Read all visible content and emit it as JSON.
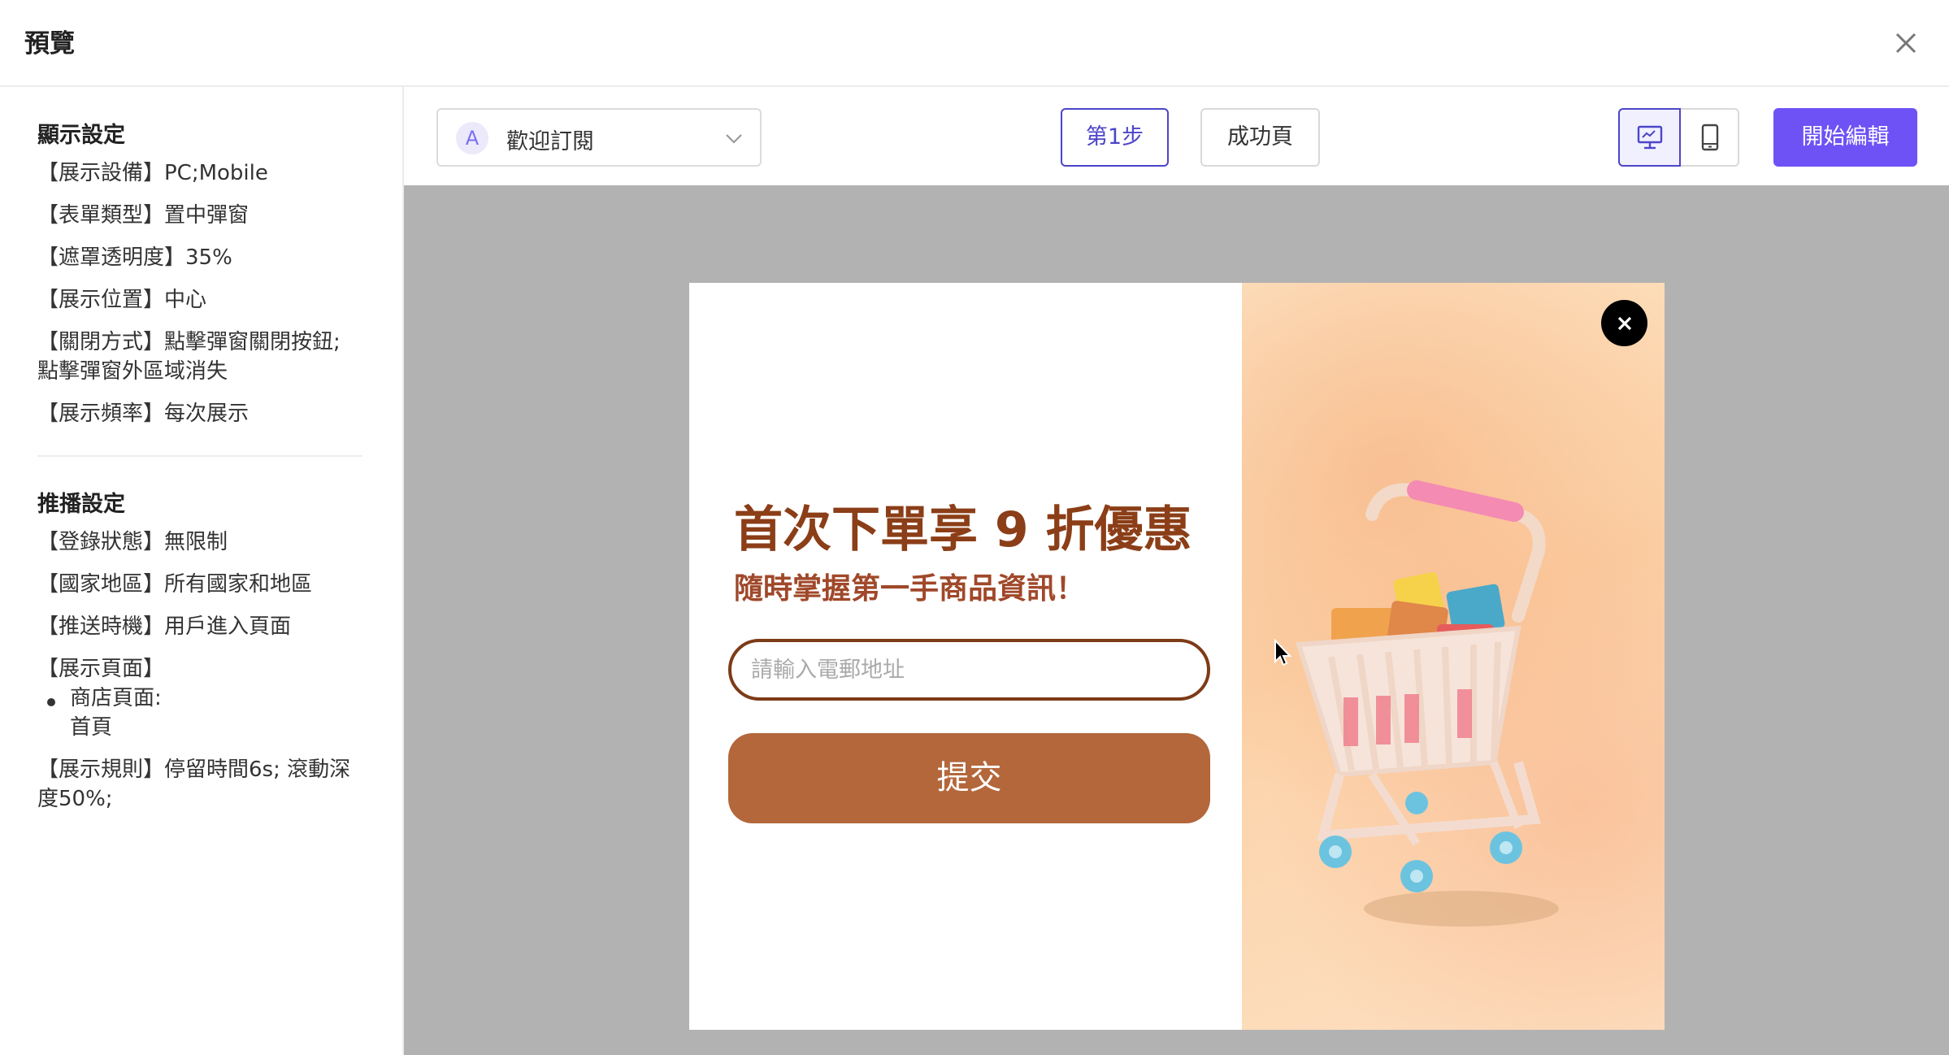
{
  "header": {
    "title": "預覽"
  },
  "sidebar": {
    "display_title": "顯示設定",
    "display_items": [
      "【展示設備】PC;Mobile",
      "【表單類型】置中彈窗",
      "【遮罩透明度】35%",
      "【展示位置】中心",
      "【關閉方式】點擊彈窗關閉按鈕;",
      "點擊彈窗外區域消失",
      "【展示頻率】每次展示"
    ],
    "push_title": "推播設定",
    "push_items": [
      "【登錄狀態】無限制",
      "【國家地區】所有國家和地區",
      "【推送時機】用戶進入頁面",
      "【展示頁面】",
      "商店頁面:",
      "首頁",
      "【展示規則】停留時間6s; 滾動深",
      "度50%;"
    ]
  },
  "toolbar": {
    "template_badge": "A",
    "template_name": "歡迎訂閱",
    "step1_label": "第1步",
    "success_label": "成功頁",
    "edit_label": "開始編輯"
  },
  "popup": {
    "heading": "首次下單享 9 折優惠",
    "subheading": "隨時掌握第一手商品資訊！",
    "email_placeholder": "請輸入電郵地址",
    "submit_label": "提交"
  },
  "colors": {
    "accent": "#4c45c9",
    "primary_button": "#6e52f5",
    "heading": "#8b3e17",
    "submit": "#b3673b",
    "overlay": "#b2b2b2"
  },
  "icons": [
    "close-icon",
    "chevron-down-icon",
    "desktop-icon",
    "mobile-icon",
    "popup-close-icon",
    "shopping-cart-illustration",
    "mouse-cursor-icon"
  ]
}
